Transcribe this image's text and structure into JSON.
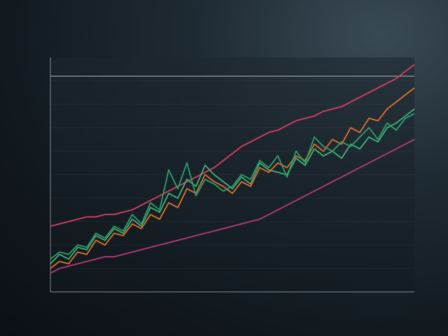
{
  "chart_data": {
    "type": "line",
    "title": "",
    "xlabel": "",
    "ylabel": "",
    "grid": false,
    "legend": "none",
    "x": [
      0,
      1,
      2,
      3,
      4,
      5,
      6,
      7,
      8,
      9,
      10,
      11,
      12,
      13,
      14,
      15,
      16,
      17,
      18,
      19,
      20,
      21,
      22,
      23,
      24,
      25,
      26,
      27,
      28,
      29,
      30,
      31,
      32,
      33,
      34,
      35,
      36,
      37,
      38,
      39,
      40
    ],
    "ylim": [
      0,
      100
    ],
    "xlim": [
      0,
      40
    ],
    "reference_line": 92,
    "series": [
      {
        "name": "",
        "color": "#d93c64",
        "values": [
          28,
          29,
          30,
          31,
          32,
          32,
          33,
          33,
          34,
          35,
          37,
          39,
          41,
          43,
          45,
          47,
          49,
          51,
          53,
          56,
          59,
          62,
          64,
          66,
          68,
          69,
          71,
          73,
          74,
          75,
          77,
          78,
          79,
          81,
          83,
          85,
          87,
          89,
          91,
          94,
          97
        ]
      },
      {
        "name": "",
        "color": "#3fb37a",
        "values": [
          12,
          16,
          14,
          19,
          18,
          24,
          22,
          27,
          25,
          31,
          28,
          36,
          34,
          42,
          40,
          48,
          45,
          54,
          50,
          47,
          44,
          49,
          46,
          55,
          52,
          51,
          50,
          57,
          54,
          61,
          58,
          60,
          57,
          63,
          61,
          66,
          64,
          70,
          72,
          75,
          78
        ]
      },
      {
        "name": "",
        "color": "#e0702a",
        "values": [
          10,
          13,
          12,
          17,
          16,
          22,
          20,
          25,
          24,
          29,
          27,
          33,
          31,
          38,
          36,
          44,
          42,
          50,
          47,
          45,
          42,
          47,
          45,
          53,
          51,
          55,
          53,
          58,
          56,
          63,
          60,
          65,
          63,
          70,
          68,
          74,
          73,
          78,
          81,
          84,
          87
        ]
      },
      {
        "name": "",
        "color": "#b43a78",
        "values": [
          8,
          10,
          11,
          12,
          13,
          14,
          15,
          15,
          16,
          17,
          18,
          19,
          20,
          21,
          22,
          23,
          24,
          25,
          26,
          27,
          28,
          29,
          30,
          31,
          33,
          35,
          37,
          39,
          41,
          43,
          45,
          47,
          49,
          51,
          53,
          55,
          57,
          59,
          61,
          63,
          65
        ]
      },
      {
        "name": "",
        "color": "#2f9e6c",
        "values": [
          14,
          17,
          16,
          20,
          19,
          25,
          23,
          28,
          26,
          33,
          29,
          38,
          35,
          52,
          44,
          55,
          41,
          48,
          46,
          43,
          45,
          50,
          48,
          56,
          53,
          58,
          49,
          60,
          55,
          66,
          62,
          60,
          64,
          62,
          66,
          70,
          65,
          72,
          69,
          74,
          76
        ]
      }
    ]
  }
}
